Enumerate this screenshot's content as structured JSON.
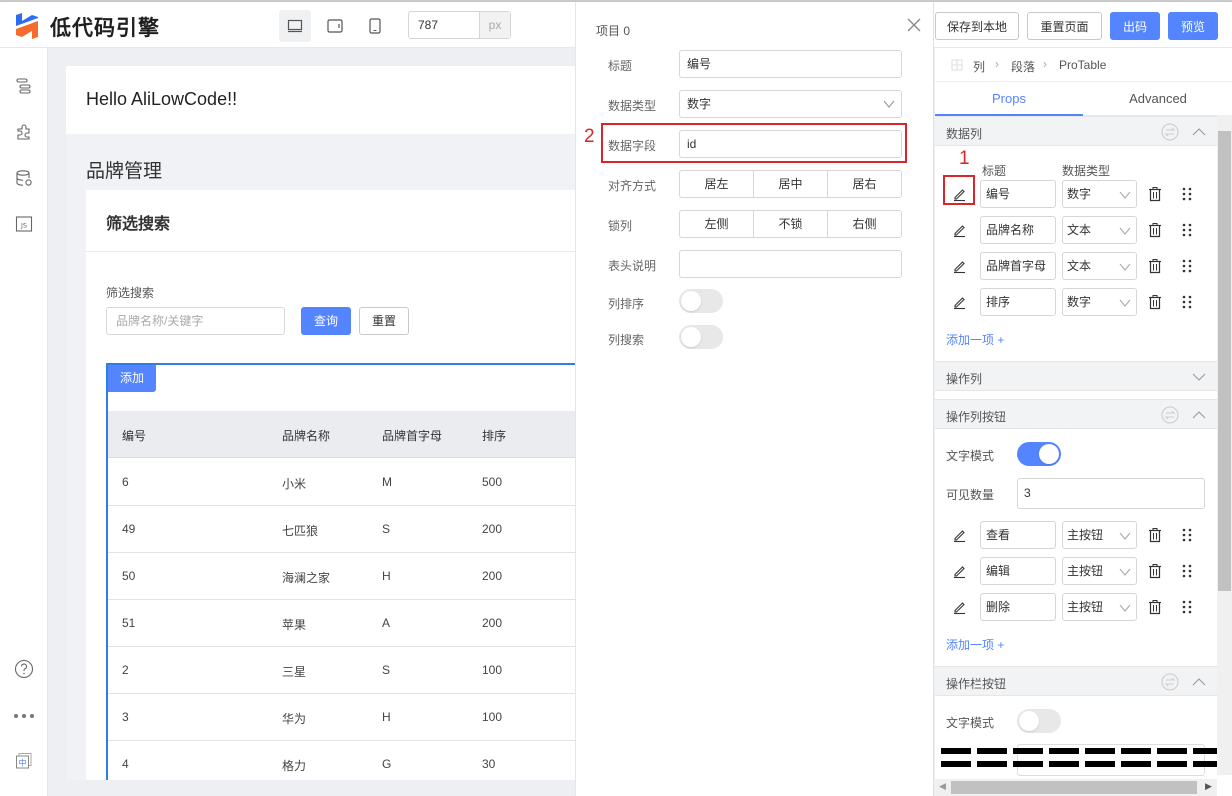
{
  "app": {
    "title": "低代码引擎",
    "logo_icon": "lowcode-logo-icon",
    "brand_colors": {
      "primary": "#5584ff",
      "logo_blue": "#2e6cf6",
      "logo_orange": "#f46b2d",
      "annotation_red": "#d9262c",
      "selection_blue": "#2f7deb"
    }
  },
  "toolbar": {
    "devices": [
      {
        "name": "desktop",
        "icon": "desktop-icon",
        "active": true
      },
      {
        "name": "tablet",
        "icon": "tablet-icon",
        "active": false
      },
      {
        "name": "phone",
        "icon": "phone-icon",
        "active": false
      }
    ],
    "canvas_width": "787",
    "canvas_width_unit": "px",
    "save_local_label": "保存到本地",
    "reset_page_label": "重置页面",
    "export_code_label": "出码",
    "preview_label": "预览"
  },
  "leftbar": {
    "top_icons": [
      "outline-tree-icon",
      "plugin-puzzle-icon",
      "datasource-icon",
      "js-code-icon"
    ],
    "bottom_icons": [
      "help-icon",
      "more-icon",
      "language-zh-icon"
    ],
    "language_glyph": "中",
    "js_glyph": "JS"
  },
  "canvas": {
    "hello_text": "Hello AliLowCode!!",
    "page_title": "品牌管理",
    "filter_card_title": "筛选搜索",
    "filter_label": "筛选搜索",
    "search_placeholder": "品牌名称/关键字",
    "query_label": "查询",
    "reset_label": "重置",
    "add_label": "添加",
    "table": {
      "columns": [
        "编号",
        "品牌名称",
        "品牌首字母",
        "排序"
      ],
      "rows": [
        [
          "6",
          "小米",
          "M",
          "500"
        ],
        [
          "49",
          "七匹狼",
          "S",
          "200"
        ],
        [
          "50",
          "海澜之家",
          "H",
          "200"
        ],
        [
          "51",
          "苹果",
          "A",
          "200"
        ],
        [
          "2",
          "三星",
          "S",
          "100"
        ],
        [
          "3",
          "华为",
          "H",
          "100"
        ],
        [
          "4",
          "格力",
          "G",
          "30"
        ]
      ]
    }
  },
  "popup": {
    "title": "项目 0",
    "fields": {
      "title_label": "标题",
      "title_value": "编号",
      "datatype_label": "数据类型",
      "datatype_value": "数字",
      "datafield_label": "数据字段",
      "datafield_value": "id",
      "align_label": "对齐方式",
      "align_options": [
        "居左",
        "居中",
        "居右"
      ],
      "lock_label": "锁列",
      "lock_options": [
        "左侧",
        "不锁",
        "右侧"
      ],
      "header_desc_label": "表头说明",
      "header_desc_value": "",
      "sortable_label": "列排序",
      "sortable_on": false,
      "searchable_label": "列搜索",
      "searchable_on": false
    },
    "annotation_2": "2"
  },
  "settings": {
    "breadcrumb": [
      "列",
      "段落",
      "ProTable"
    ],
    "tabs": [
      {
        "label": "Props",
        "active": true
      },
      {
        "label": "Advanced",
        "active": false
      }
    ],
    "data_columns": {
      "title": "数据列",
      "col_title_header": "标题",
      "col_type_header": "数据类型",
      "annotation_1": "1",
      "items": [
        {
          "title": "编号",
          "type": "数字"
        },
        {
          "title": "品牌名称",
          "type": "文本"
        },
        {
          "title": "品牌首字母",
          "type": "文本"
        },
        {
          "title": "排序",
          "type": "数字"
        }
      ],
      "add_label": "添加一项 +"
    },
    "action_column": {
      "title": "操作列",
      "expanded": false
    },
    "action_column_buttons": {
      "title": "操作列按钮",
      "text_mode_label": "文字模式",
      "text_mode_on": true,
      "visible_count_label": "可见数量",
      "visible_count_value": "3",
      "items": [
        {
          "title": "查看",
          "type": "主按钮"
        },
        {
          "title": "编辑",
          "type": "主按钮"
        },
        {
          "title": "删除",
          "type": "主按钮"
        }
      ],
      "add_label": "添加一项 +"
    },
    "toolbar_buttons": {
      "title": "操作栏按钮",
      "text_mode_label": "文字模式",
      "text_mode_on": false
    }
  }
}
